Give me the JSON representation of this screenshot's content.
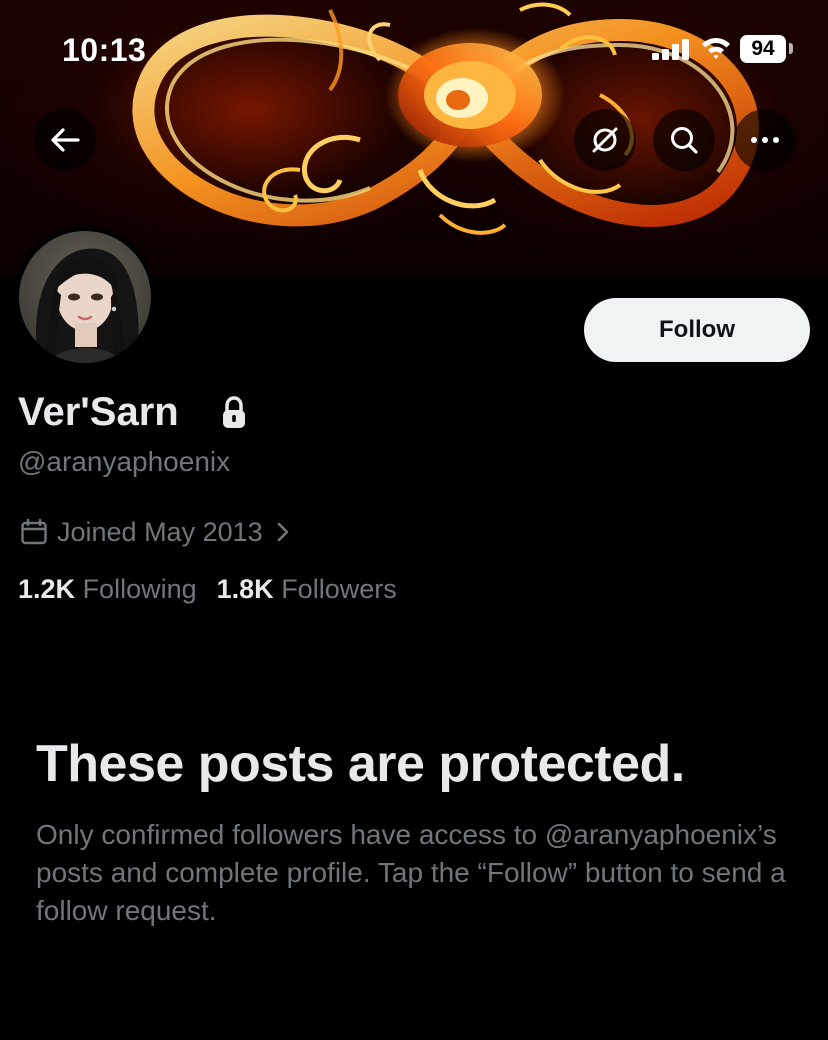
{
  "status_bar": {
    "time": "10:13",
    "battery": "94"
  },
  "header": {
    "back_icon": "arrow-left-icon",
    "notify_icon": "slashed-circle-icon",
    "search_icon": "search-icon",
    "more_icon": "more-dots-icon"
  },
  "profile": {
    "name": "Ver'Sarn",
    "handle": "@aranyaphoenix",
    "joined": "Joined May 2013",
    "following_count": "1.2K",
    "following_label": "Following",
    "followers_count": "1.8K",
    "followers_label": "Followers",
    "follow_label": "Follow"
  },
  "protected": {
    "title": "These posts are protected.",
    "body": "Only confirmed followers have access to @aranyaphoenix’s posts and complete profile. Tap the “Follow” button to send a follow request."
  },
  "colors": {
    "background": "#000000",
    "muted_text": "#71767b",
    "primary_text": "#e7e9ea",
    "follow_button": "#eff3f4"
  }
}
